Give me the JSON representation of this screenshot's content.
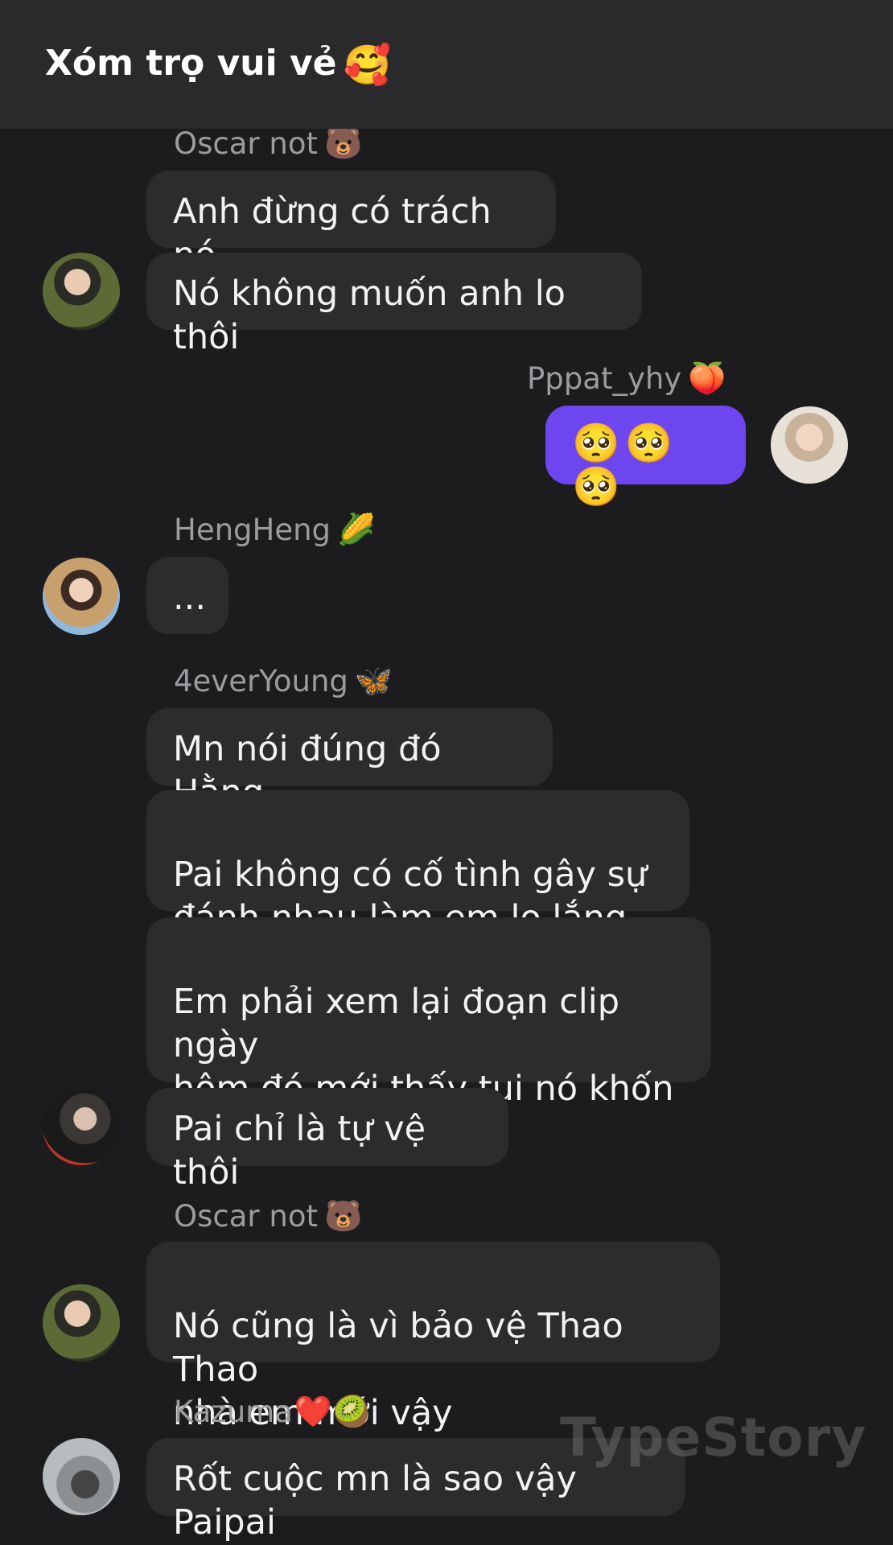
{
  "header": {
    "title": "Xóm trọ vui vẻ",
    "emoji": "🥰"
  },
  "messages": [
    {
      "sender": "Oscar not",
      "sender_emoji": "🐻",
      "avatar": "avatar-oscar",
      "lines": [
        "Anh đừng có trách nó",
        "Nó không muốn anh lo thôi"
      ]
    },
    {
      "sender": "Pppat_yhy",
      "sender_emoji": "🍑",
      "avatar": "avatar-pppat",
      "mine": true,
      "lines": [
        "🥺🥺🥺"
      ]
    },
    {
      "sender": "HengHeng",
      "sender_emoji": "🌽",
      "avatar": "avatar-hengheng",
      "lines": [
        "..."
      ]
    },
    {
      "sender": "4everYoung",
      "sender_emoji": "🦋",
      "avatar": "avatar-4everyoung",
      "lines": [
        "Mn nói đúng đó Hằng",
        "Pai không có cố tình gây sự\nđánh nhau làm em lo lắng đâu",
        "Em phải xem lại đoạn clip ngày\nhôm đó mới thấy tụi nó khốn\nnạn như thế nào",
        "Pai chỉ là tự vệ thôi"
      ]
    },
    {
      "sender": "Oscar not",
      "sender_emoji": "🐻",
      "avatar": "avatar-oscar",
      "lines": [
        "Nó cũng là vì bảo vệ Thao Thao\nnhà em mới vậy"
      ]
    },
    {
      "sender": "Kazuma",
      "sender_emoji": "❤️🥝",
      "avatar": "avatar-kazuma",
      "lines": [
        "Rốt cuộc mn là sao vậy Paipai"
      ]
    }
  ],
  "watermark": "TypeStory"
}
